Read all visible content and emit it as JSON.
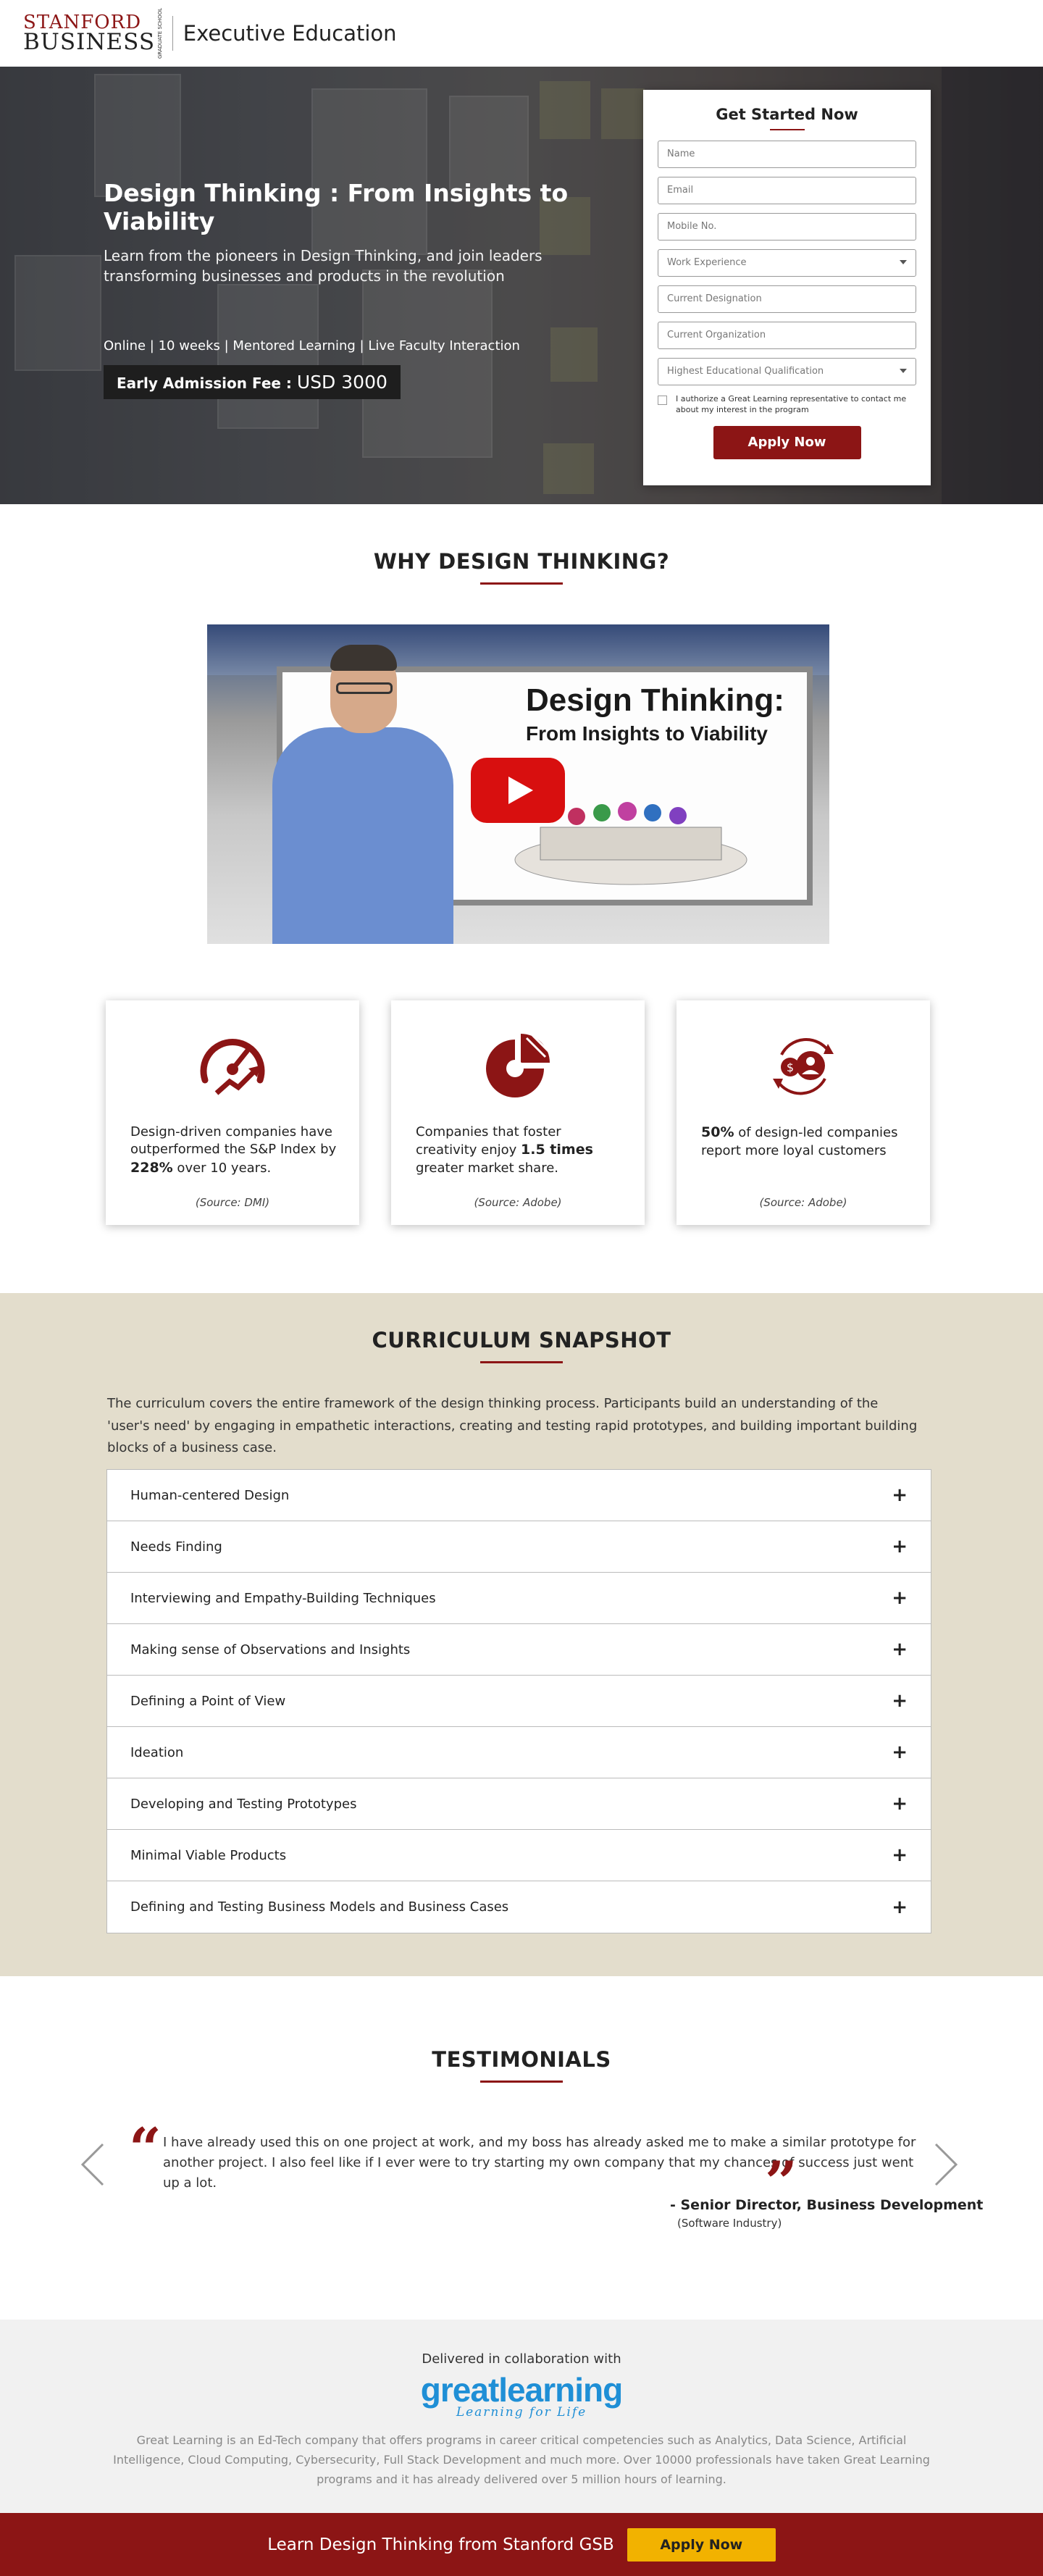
{
  "header": {
    "logo_line1": "STANFORD",
    "logo_line2": "BUSINESS",
    "logo_side": "GRADUATE SCHOOL",
    "title": "Executive Education"
  },
  "hero": {
    "title": "Design Thinking : From Insights to Viability",
    "subtitle": "Learn from the pioneers in Design Thinking, and join leaders transforming businesses and products in the revolution",
    "meta": "Online | 10 weeks | Mentored Learning | Live Faculty Interaction",
    "fee_label": "Early Admission Fee :",
    "fee_amount": "USD 3000"
  },
  "form": {
    "title": "Get Started Now",
    "fields": {
      "name": "Name",
      "email": "Email",
      "mobile": "Mobile No.",
      "experience": "Work Experience",
      "designation": "Current Designation",
      "organization": "Current Organization",
      "qualification": "Highest Educational Qualification"
    },
    "consent": "I authorize a Great Learning representative to contact me about my interest in the program",
    "submit": "Apply Now"
  },
  "why": {
    "title": "WHY DESIGN THINKING?",
    "video_title": "Design Thinking:",
    "video_subtitle": "From Insights to Viability"
  },
  "stats": [
    {
      "pre": "Design-driven companies have outperformed the S&P Index by ",
      "bold": "228%",
      "post": " over 10 years.",
      "source": "(Source: DMI)",
      "icon": "speedometer-growth-icon"
    },
    {
      "pre": "Companies that foster creativity enjoy ",
      "bold": "1.5 times",
      "post": " greater market share.",
      "source": "(Source: Adobe)",
      "icon": "pie-chart-icon"
    },
    {
      "pre": "",
      "bold": "50%",
      "post": " of design-led companies report more loyal customers",
      "source": "(Source: Adobe)",
      "icon": "customer-loyalty-icon"
    }
  ],
  "curriculum": {
    "title": "CURRICULUM SNAPSHOT",
    "description": "The curriculum covers the entire framework of the design thinking process. Participants build an understanding of the 'user's need' by engaging in empathetic interactions, creating and testing rapid prototypes, and building important building blocks of a business case.",
    "items": [
      "Human-centered Design",
      "Needs Finding",
      "Interviewing and Empathy-Building Techniques",
      "Making sense of Observations and Insights",
      "Defining a Point of View",
      "Ideation",
      "Developing and Testing Prototypes",
      "Minimal Viable Products",
      "Defining and Testing Business Models and Business Cases"
    ],
    "expand_symbol": "+"
  },
  "testimonials": {
    "title": "TESTIMONIALS",
    "quote": "I have already used this on one project at work, and my boss has already asked me to make a similar prototype for another project. I also feel like if I ever were to try starting my own company that my chances of success just went up a lot.",
    "author": "- Senior Director, Business Development",
    "company": "(Software Industry)"
  },
  "footer": {
    "collab": "Delivered in collaboration with",
    "gl_name": "greatlearning",
    "gl_tagline": "Learning for Life",
    "text": "Great Learning is an Ed-Tech company that offers programs in career critical competencies such as Analytics, Data Science, Artificial Intelligence, Cloud Computing, Cybersecurity, Full Stack Development and much more. Over 10000 professionals have taken Great Learning programs and it has already delivered over 5 million hours of learning."
  },
  "sticky_bar": {
    "text": "Learn Design Thinking from Stanford GSB",
    "button": "Apply Now"
  },
  "colors": {
    "brand_red": "#8c1515",
    "cta_yellow": "#f2b200",
    "curriculum_bg": "#e3ddcc",
    "gl_blue": "#1f8fd6"
  }
}
